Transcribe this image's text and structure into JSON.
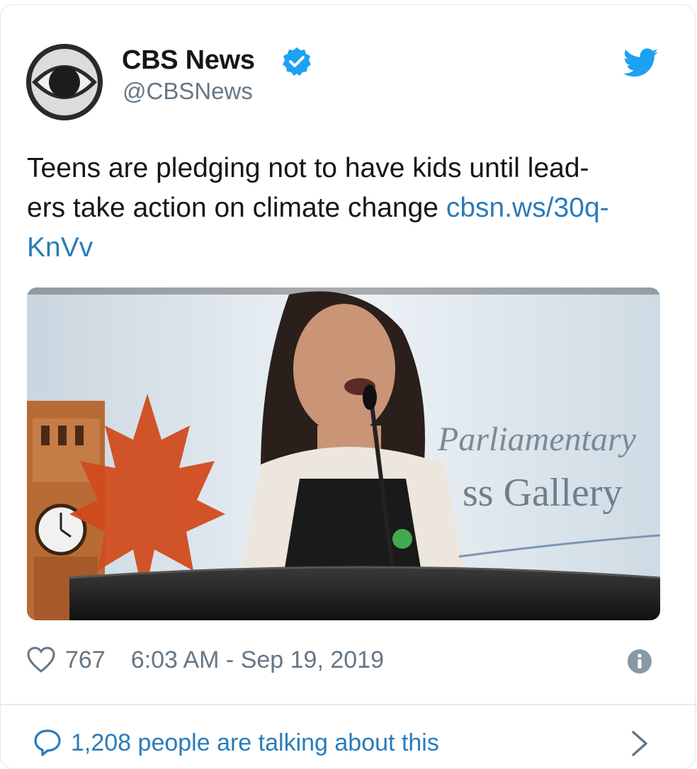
{
  "account": {
    "name": "CBS News",
    "handle": "@CBSNews"
  },
  "tweet": {
    "lines": [
      "Teens are pledging not to have kids until lead-",
      "ers take action on climate change "
    ],
    "link_line1": "cbsn.ws/30q-",
    "link_line2": "KnVv"
  },
  "media": {
    "sign_line1": "Parliamentary",
    "sign_line2": "ss Gallery"
  },
  "meta": {
    "likes": "767",
    "timestamp": "6:03 AM - Sep 19, 2019"
  },
  "footer": {
    "talking": "1,208 people are talking about this"
  },
  "colors": {
    "link": "#2b7bb9",
    "muted": "#657786",
    "verified": "#1da1f2",
    "twitter": "#1da1f2"
  },
  "icons": [
    "cbs-eye-logo",
    "verified-badge-icon",
    "twitter-bird-icon",
    "heart-icon",
    "info-icon",
    "speech-bubble-icon",
    "chevron-right-icon"
  ]
}
